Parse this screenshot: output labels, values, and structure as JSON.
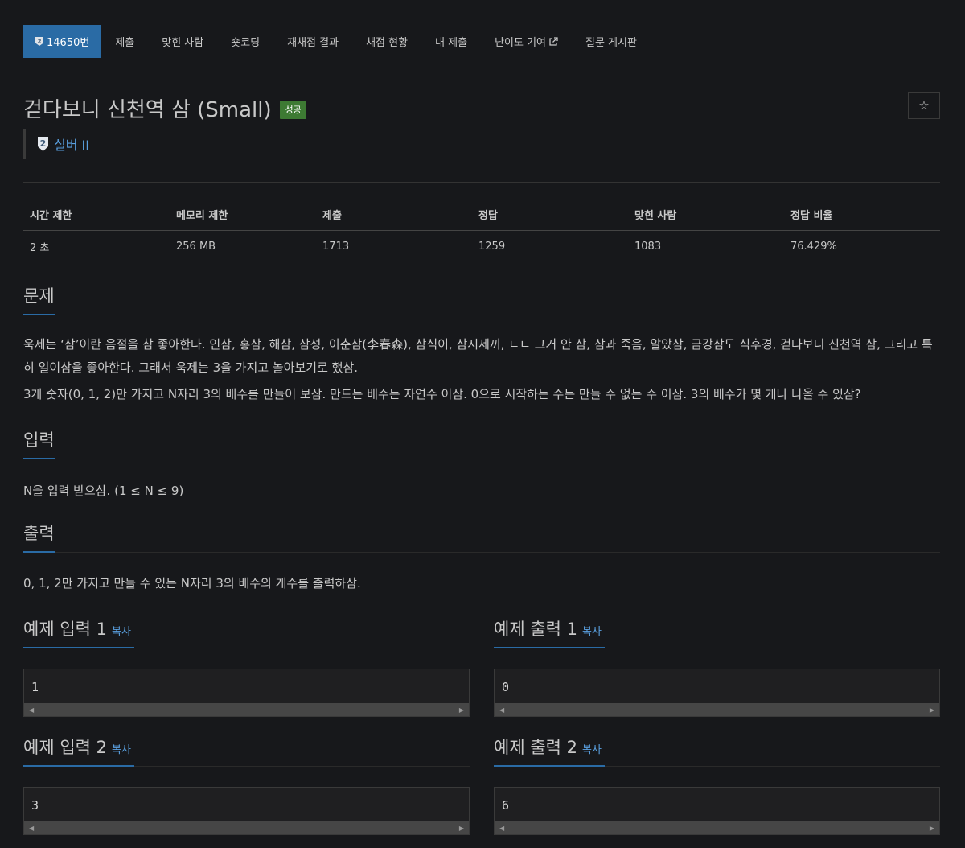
{
  "nav": {
    "tabs": [
      {
        "label": "14650번",
        "active": true
      },
      {
        "label": "제출"
      },
      {
        "label": "맞힌 사람"
      },
      {
        "label": "숏코딩"
      },
      {
        "label": "재채점 결과"
      },
      {
        "label": "채점 현황"
      },
      {
        "label": "내 제출"
      },
      {
        "label": "난이도 기여"
      },
      {
        "label": "질문 게시판"
      }
    ]
  },
  "problem": {
    "title": "걷다보니 신천역 삼 (Small)",
    "status_badge": "성공",
    "star_icon": "☆",
    "tier_number": "2",
    "tier_label": "실버 II"
  },
  "info_table": {
    "headers": [
      "시간 제한",
      "메모리 제한",
      "제출",
      "정답",
      "맞힌 사람",
      "정답 비율"
    ],
    "values": [
      "2 초",
      "256 MB",
      "1713",
      "1259",
      "1083",
      "76.429%"
    ]
  },
  "sections": {
    "description_title": "문제",
    "description": [
      "욱제는 ‘삼’이란 음절을 참 좋아한다. 인삼, 홍삼, 해삼, 삼성, 이춘삼(李春森), 삼식이, 삼시세끼, ㄴㄴ 그거 안 삼, 삼과 죽음, 알았삼, 금강삼도 식후경, 걷다보니 신천역 삼, 그리고 특히 일이삼을 좋아한다. 그래서 욱제는 3을 가지고 놀아보기로 했삼.",
      "3개 숫자(0, 1, 2)만 가지고 N자리 3의 배수를 만들어 보삼. 만드는 배수는 자연수 이삼. 0으로 시작하는 수는 만들 수 없는 수 이삼. 3의 배수가 몇 개나 나올 수 있삼?"
    ],
    "input_title": "입력",
    "input": "N을 입력 받으삼. (1 ≤ N ≤ 9)",
    "output_title": "출력",
    "output": "0, 1, 2만 가지고 만들 수 있는 N자리 3의 배수의 개수를 출력하삼."
  },
  "samples": {
    "copy_label": "복사",
    "input1_title": "예제 입력 1",
    "input1_value": "1",
    "output1_title": "예제 출력 1",
    "output1_value": "0",
    "input2_title": "예제 입력 2",
    "input2_value": "3",
    "output2_title": "예제 출력 2",
    "output2_value": "6"
  },
  "colors": {
    "background": "#17181b",
    "accent": "#2a6ba5",
    "link": "#5aa0e0",
    "success": "#3d7a33"
  }
}
